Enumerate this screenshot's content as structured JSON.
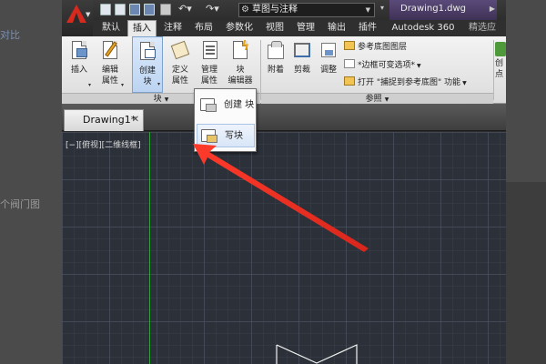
{
  "background": {
    "fragment_top": "对比 ",
    "fragment_mid": "个阀门图"
  },
  "titlebar": {
    "workspace": "草图与注释",
    "document_title": "Drawing1.dwg"
  },
  "ribbon_tabs": [
    {
      "label": "默认",
      "active": false
    },
    {
      "label": "插入",
      "active": true
    },
    {
      "label": "注释",
      "active": false
    },
    {
      "label": "布局",
      "active": false
    },
    {
      "label": "参数化",
      "active": false
    },
    {
      "label": "视图",
      "active": false
    },
    {
      "label": "管理",
      "active": false
    },
    {
      "label": "输出",
      "active": false
    },
    {
      "label": "插件",
      "active": false
    },
    {
      "label": "Autodesk 360",
      "active": false
    },
    {
      "label": "精选应",
      "active": false
    }
  ],
  "ribbon": {
    "tools": {
      "insert": "插入",
      "edit_attr_1": "编辑",
      "edit_attr_2": "属性",
      "create_block_1": "创建",
      "create_block_2": "块",
      "define_attr_1": "定义",
      "define_attr_2": "属性",
      "manage_attr_1": "管理",
      "manage_attr_2": "属性",
      "block_editor_1": "块",
      "block_editor_2": "编辑器",
      "attach": "附着",
      "clip": "剪裁",
      "adjust": "调整",
      "right_1": "创",
      "right_2": "点"
    },
    "reference_lines": {
      "underlay_layers": "参考底图图层",
      "frame_variable": "*边框可变选项*",
      "open": "打开",
      "snap_underlay": "\"捕捉到参考底图\"",
      "function": "功能"
    },
    "panels": {
      "block": "块",
      "reference": "参照"
    }
  },
  "document_tab": {
    "label": "Drawing1*"
  },
  "canvas": {
    "viewport_label": "[−][俯视][二维线框]"
  },
  "dropdown": {
    "items": [
      {
        "label": "创建 块",
        "hover": false
      },
      {
        "label": "写块",
        "hover": true
      }
    ]
  },
  "colors": {
    "accent_red": "#e23a2a",
    "selection_blue": "#bcd4f2",
    "canvas_bg": "#2b3039",
    "y_axis_green": "#2fa33b"
  }
}
